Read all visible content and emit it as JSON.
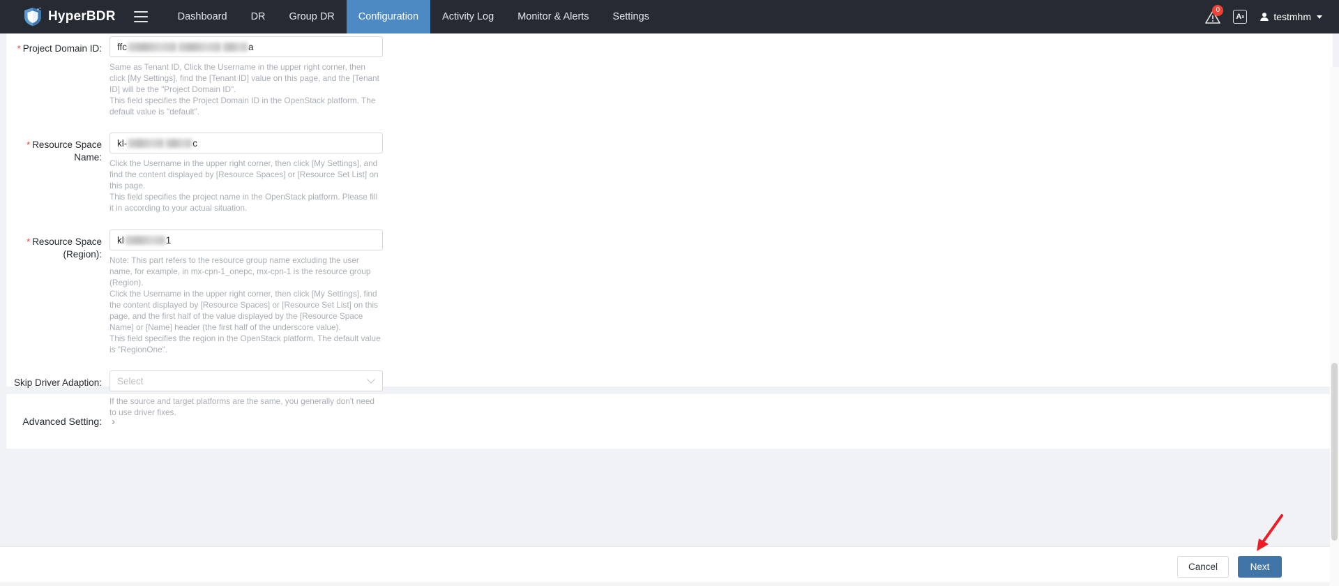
{
  "header": {
    "brand": "HyperBDR",
    "logo_icon": "shield-logo-icon",
    "menu_icon": "hamburger-menu-icon",
    "nav": [
      {
        "label": "Dashboard",
        "active": false
      },
      {
        "label": "DR",
        "active": false
      },
      {
        "label": "Group DR",
        "active": false
      },
      {
        "label": "Configuration",
        "active": true
      },
      {
        "label": "Activity Log",
        "active": false
      },
      {
        "label": "Monitor & Alerts",
        "active": false
      },
      {
        "label": "Settings",
        "active": false
      }
    ],
    "alert_icon": "alert-triangle-icon",
    "alert_count": "0",
    "language_icon": "translate-icon",
    "language_label": "A",
    "language_sup": "x",
    "user_icon": "user-avatar-icon",
    "username": "testmhm",
    "caret_icon": "chevron-down-icon",
    "accent_color": "#4d8ac4",
    "background_color": "#262b33"
  },
  "form": {
    "project_domain_id": {
      "label": "Project Domain ID:",
      "required": true,
      "value_prefix": "ffc",
      "value_suffix": "a",
      "help": [
        "Same as Tenant ID, Click the Username in the upper right corner, then click [My Settings], find the [Tenant ID] value on this page, and the [Tenant ID] will be the \"Project Domain ID\".",
        "This field specifies the Project Domain ID in the OpenStack platform. The default value is \"default\"."
      ]
    },
    "resource_space_name": {
      "label": "Resource Space Name:",
      "required": true,
      "value_prefix": "kl-",
      "value_suffix": "c",
      "help": [
        "Click the Username in the upper right corner, then click [My Settings], and find the content displayed by [Resource Spaces] or [Resource Set List] on this page.",
        "This field specifies the project name in the OpenStack platform. Please fill it in according to your actual situation."
      ]
    },
    "resource_space_region": {
      "label_line1": "Resource Space",
      "label_line2": "(Region):",
      "required": true,
      "value_prefix": "kl",
      "value_suffix": "1",
      "help": [
        "Note: This part refers to the resource group name excluding the user name, for example, in mx-cpn-1_onepc, mx-cpn-1 is the resource group (Region).",
        "Click the Username in the upper right corner, then click [My Settings], find the content displayed by [Resource Spaces] or [Resource Set List] on this page, and the first half of the value displayed by the [Resource Space Name] or [Name] header (the first half of the underscore value).",
        "This field specifies the region in the OpenStack platform. The default value is \"RegionOne\"."
      ]
    },
    "skip_driver_adaption": {
      "label": "Skip Driver Adaption:",
      "required": false,
      "placeholder": "Select",
      "dropdown_icon": "chevron-down-icon",
      "help": [
        "If the source and target platforms are the same, you generally don't need to use driver fixes."
      ]
    }
  },
  "advanced": {
    "label": "Advanced Setting:",
    "expand_icon": "chevron-right-icon",
    "expand_glyph": "›"
  },
  "footer": {
    "cancel_label": "Cancel",
    "next_label": "Next",
    "primary_color": "#4175a8",
    "annotation_icon": "red-arrow-annotation",
    "annotation_color": "#ee1c25"
  }
}
